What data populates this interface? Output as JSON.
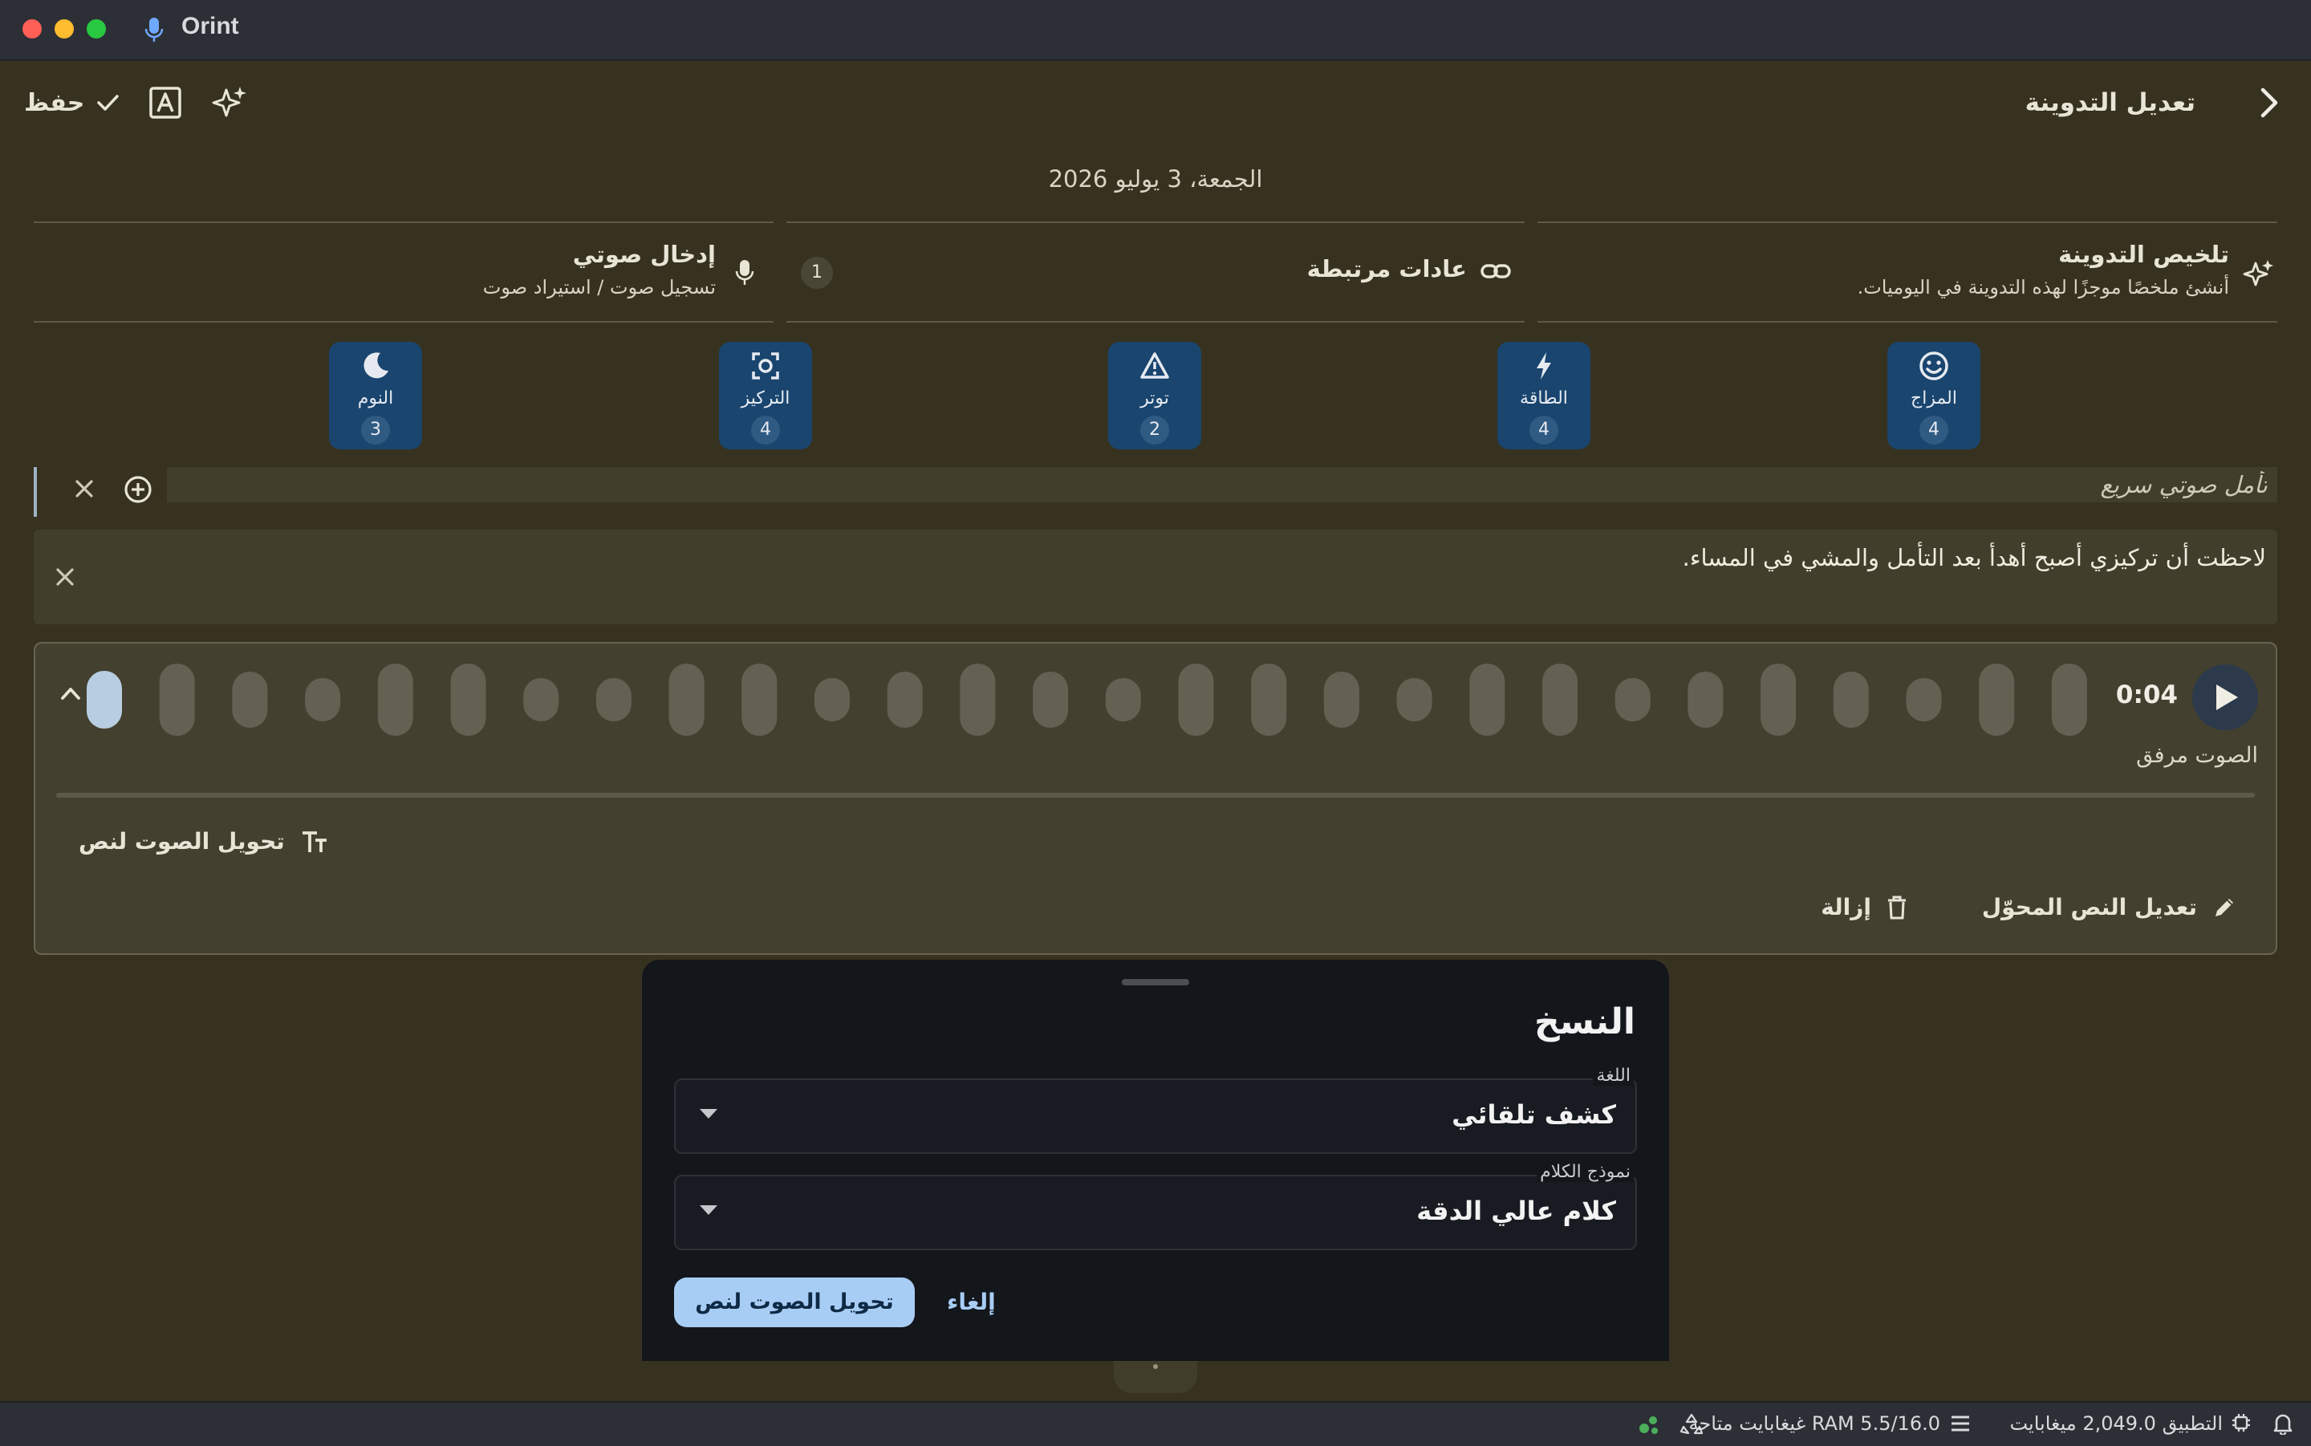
{
  "window": {
    "title": "Orint"
  },
  "header": {
    "title": "تعديل التدوينة",
    "save_label": "حفظ"
  },
  "date": "الجمعة، 3 يوليو 2026",
  "cards": {
    "summarize": {
      "title": "تلخيص التدوينة",
      "subtitle": "أنشئ ملخصًا موجزًا لهذه التدوينة في اليوميات."
    },
    "habits": {
      "title": "عادات مرتبطة",
      "count": "1"
    },
    "voice": {
      "title": "إدخال صوتي",
      "subtitle": "تسجيل صوت / استيراد صوت"
    }
  },
  "metrics": [
    {
      "label": "المزاج",
      "count": "4",
      "icon": "smile-icon"
    },
    {
      "label": "الطاقة",
      "count": "4",
      "icon": "bolt-icon"
    },
    {
      "label": "توتر",
      "count": "2",
      "icon": "warning-icon"
    },
    {
      "label": "التركيز",
      "count": "4",
      "icon": "focus-icon"
    },
    {
      "label": "النوم",
      "count": "3",
      "icon": "moon-icon"
    }
  ],
  "quick_voice": {
    "placeholder": "تأمل صوتي سريع"
  },
  "note": {
    "text": "لاحظت أن تركيزي أصبح أهدأ بعد التأمل والمشي في المساء."
  },
  "audio": {
    "duration": "0:04",
    "status": "الصوت مرفق",
    "transcribe_label": "تحويل الصوت لنص",
    "edit_label": "تعديل النص المحوّل",
    "remove_label": "إزالة",
    "progress": 0
  },
  "sheet": {
    "title": "النسخ",
    "language": {
      "label": "اللغة",
      "value": "كشف تلقائي"
    },
    "model": {
      "label": "نموذج الكلام",
      "value": "كلام عالي الدقة"
    },
    "primary_label": "تحويل الصوت لنص",
    "cancel_label": "إلغاء"
  },
  "statusbar": {
    "app_memory": "التطبيق 2,049.0 ميغابايت",
    "ram": "RAM 5.5/16.0 غيغابايت متاحة"
  },
  "colors": {
    "metric_bg": "#19456f",
    "accent": "#a8cdf5",
    "background": "#37321f"
  }
}
